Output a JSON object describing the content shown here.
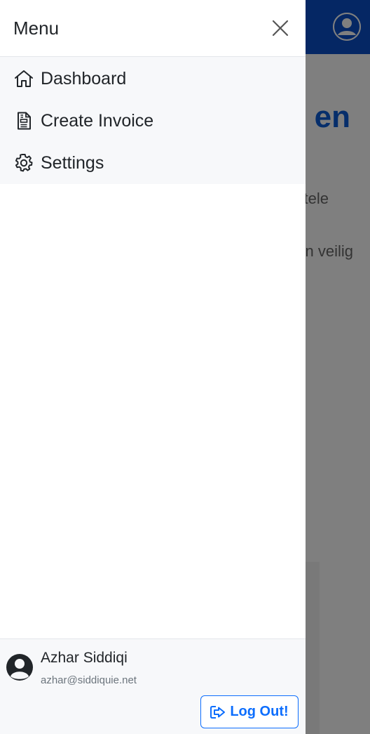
{
  "background": {
    "heading_fragment": "en",
    "line1_fragment": "tele",
    "line2_fragment": "n veilig"
  },
  "drawer": {
    "title": "Menu",
    "nav_items": [
      {
        "label": "Dashboard",
        "icon": "house-icon"
      },
      {
        "label": "Create Invoice",
        "icon": "file-invoice-icon"
      },
      {
        "label": "Settings",
        "icon": "gear-icon"
      }
    ]
  },
  "user": {
    "name": "Azhar Siddiqi",
    "email": "azhar@siddiquie.net"
  },
  "logout": {
    "label": "Log Out!",
    "icon": "logout-icon"
  },
  "colors": {
    "topbar": "#0a4fc8",
    "accent": "#0d6efd",
    "drawer_bg": "#ffffff",
    "nav_bg": "#f7f8fa"
  }
}
